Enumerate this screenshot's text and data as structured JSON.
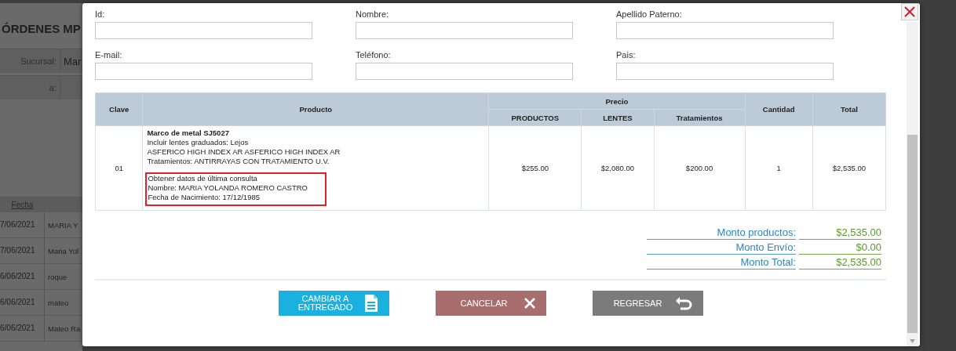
{
  "background_page": {
    "title": "ÓRDENES MP",
    "filters": [
      {
        "label": "Sucursal:",
        "value": "Mar"
      },
      {
        "label": "a:"
      }
    ],
    "table": {
      "column_1": "Fecha",
      "rows": [
        {
          "fecha": "7/06/2021",
          "cliente": "MARIA Y"
        },
        {
          "fecha": "7/06/2021",
          "cliente": "Maria Yol"
        },
        {
          "fecha": "6/06/2021",
          "cliente": "roque"
        },
        {
          "fecha": "6/06/2021",
          "cliente": "mateo"
        },
        {
          "fecha": "6/06/2021",
          "cliente": "Mateo Ra"
        }
      ]
    }
  },
  "modal": {
    "fields": [
      {
        "label": "Id:"
      },
      {
        "label": "Nombre:"
      },
      {
        "label": "Apellido Paterno:"
      },
      {
        "label": "E-mail:"
      },
      {
        "label": "Teléfono:"
      },
      {
        "label": "Pais:"
      }
    ],
    "table": {
      "columns": {
        "clave": "Clave",
        "producto": "Producto",
        "precio": "Precio",
        "productos": "PRODUCTOS",
        "lentes": "LENTES",
        "tratamientos": "Tratamientos",
        "cantidad": "Cantidad",
        "total": "Total"
      },
      "rows": [
        {
          "clave": "01",
          "product_name": "Marco de metal SJ5027",
          "details": [
            "Incluir lentes graduados: Lejos",
            "ASFERICO HIGH INDEX AR ASFERICO HIGH INDEX AR",
            "Tratamientos: ANTIRRAYAS CON TRATAMIENTO U.V."
          ],
          "consulta": [
            "Obtener datos de última consulta",
            "Nombre: MARIA YOLANDA ROMERO CASTRO",
            "Fecha de Nacimiento: 17/12/1985"
          ],
          "consulta_highlighted": true,
          "productos": "$255.00",
          "lentes": "$2,080.00",
          "tratamientos": "$200.00",
          "cantidad": "1",
          "total": "$2,535.00"
        }
      ]
    },
    "totals": [
      {
        "label": "Monto productos:",
        "value": "$2,535.00"
      },
      {
        "label": "Monto Envío:",
        "value": "$0.00"
      },
      {
        "label": "Monto Total:",
        "value": "$2,535.00"
      }
    ],
    "buttons": [
      {
        "kind": "deliver",
        "label_lines": [
          "CAMBIAR A",
          "ENTREGADO"
        ]
      },
      {
        "kind": "cancel",
        "label_lines": [
          "CANCELAR"
        ]
      },
      {
        "kind": "back",
        "label_lines": [
          "REGRESAR"
        ]
      }
    ]
  }
}
